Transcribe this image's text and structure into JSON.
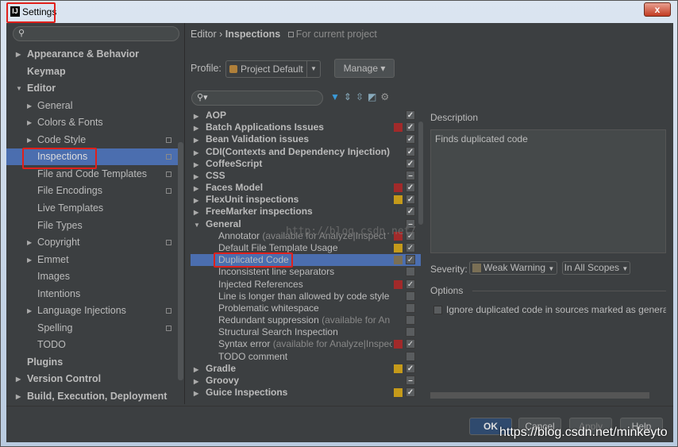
{
  "window": {
    "title": "Settings",
    "close_label": "x"
  },
  "sidebar": {
    "items": [
      {
        "label": "Appearance & Behavior",
        "level": 0,
        "bold": true,
        "arrow": "right"
      },
      {
        "label": "Keymap",
        "level": 0,
        "bold": true
      },
      {
        "label": "Editor",
        "level": 0,
        "bold": true,
        "arrow": "down"
      },
      {
        "label": "General",
        "level": 1,
        "arrow": "right"
      },
      {
        "label": "Colors & Fonts",
        "level": 1,
        "arrow": "right"
      },
      {
        "label": "Code Style",
        "level": 1,
        "arrow": "right",
        "project": true
      },
      {
        "label": "Inspections",
        "level": 1,
        "selected": true,
        "project": true
      },
      {
        "label": "File and Code Templates",
        "level": 1,
        "project": true
      },
      {
        "label": "File Encodings",
        "level": 1,
        "project": true
      },
      {
        "label": "Live Templates",
        "level": 1
      },
      {
        "label": "File Types",
        "level": 1
      },
      {
        "label": "Copyright",
        "level": 1,
        "arrow": "right",
        "project": true
      },
      {
        "label": "Emmet",
        "level": 1,
        "arrow": "right"
      },
      {
        "label": "Images",
        "level": 1
      },
      {
        "label": "Intentions",
        "level": 1
      },
      {
        "label": "Language Injections",
        "level": 1,
        "arrow": "right",
        "project": true
      },
      {
        "label": "Spelling",
        "level": 1,
        "project": true
      },
      {
        "label": "TODO",
        "level": 1
      },
      {
        "label": "Plugins",
        "level": 0,
        "bold": true
      },
      {
        "label": "Version Control",
        "level": 0,
        "bold": true,
        "arrow": "right"
      },
      {
        "label": "Build, Execution, Deployment",
        "level": 0,
        "bold": true,
        "arrow": "right"
      }
    ]
  },
  "header": {
    "crumb_parent": "Editor",
    "crumb_sep": "›",
    "crumb_current": "Inspections",
    "scope_note": "For current project"
  },
  "profile": {
    "label": "Profile:",
    "value": "Project Default",
    "manage_label": "Manage ▾"
  },
  "colors": {
    "error": "#a12a2a",
    "warning": "#c59a1a",
    "weak": "#7a6f55",
    "selection": "#4b6eaf"
  },
  "tree": [
    {
      "label": "AOP",
      "group": true,
      "arrow": "right",
      "check": "on"
    },
    {
      "label": "Batch Applications Issues",
      "group": true,
      "arrow": "right",
      "sev": "error",
      "check": "on"
    },
    {
      "label": "Bean Validation issues",
      "group": true,
      "arrow": "right",
      "check": "on"
    },
    {
      "label": "CDI(Contexts and Dependency Injection) is",
      "group": true,
      "arrow": "right",
      "check": "on"
    },
    {
      "label": "CoffeeScript",
      "group": true,
      "arrow": "right",
      "check": "on"
    },
    {
      "label": "CSS",
      "group": true,
      "arrow": "right",
      "check": "partial"
    },
    {
      "label": "Faces Model",
      "group": true,
      "arrow": "right",
      "sev": "error",
      "check": "on"
    },
    {
      "label": "FlexUnit inspections",
      "group": true,
      "arrow": "right",
      "sev": "warning",
      "check": "on"
    },
    {
      "label": "FreeMarker inspections",
      "group": true,
      "arrow": "right",
      "check": "on"
    },
    {
      "label": "General",
      "group": true,
      "arrow": "down",
      "check": "partial"
    },
    {
      "label": "Annotator",
      "note": " (available for Analyze|Inspect",
      "sev": "error",
      "check": "on"
    },
    {
      "label": "Default File Template Usage",
      "sev": "warning",
      "check": "on"
    },
    {
      "label": "Duplicated Code",
      "sev": "weak",
      "check": "on",
      "selected": true
    },
    {
      "label": "Inconsistent line separators",
      "check": "off"
    },
    {
      "label": "Injected References",
      "sev": "error",
      "check": "on"
    },
    {
      "label": "Line is longer than allowed by code style",
      "check": "off"
    },
    {
      "label": "Problematic whitespace",
      "check": "off"
    },
    {
      "label": "Redundant suppression",
      "note": " (available for An",
      "check": "off"
    },
    {
      "label": "Structural Search Inspection",
      "check": "off"
    },
    {
      "label": "Syntax error",
      "note": " (available for Analyze|Inspec",
      "sev": "error",
      "check": "on"
    },
    {
      "label": "TODO comment",
      "check": "off"
    },
    {
      "label": "Gradle",
      "group": true,
      "arrow": "right",
      "sev": "warning",
      "check": "on"
    },
    {
      "label": "Groovy",
      "group": true,
      "arrow": "right",
      "check": "partial"
    },
    {
      "label": "Guice Inspections",
      "group": true,
      "arrow": "right",
      "sev": "warning",
      "check": "on"
    }
  ],
  "details": {
    "description_label": "Description",
    "description_text": "Finds duplicated code",
    "severity_label": "Severity:",
    "severity_value": "Weak Warning",
    "scope_value": "In All Scopes",
    "options_label": "Options",
    "option_ignore": "Ignore duplicated code in sources marked as genera"
  },
  "footer": {
    "ok": "OK",
    "cancel": "Cancel",
    "apply": "Apply",
    "help": "Help"
  },
  "watermark": "https://blog.csdn.net/minkeyto",
  "tree_watermark": "http://blog.csdn.net/"
}
